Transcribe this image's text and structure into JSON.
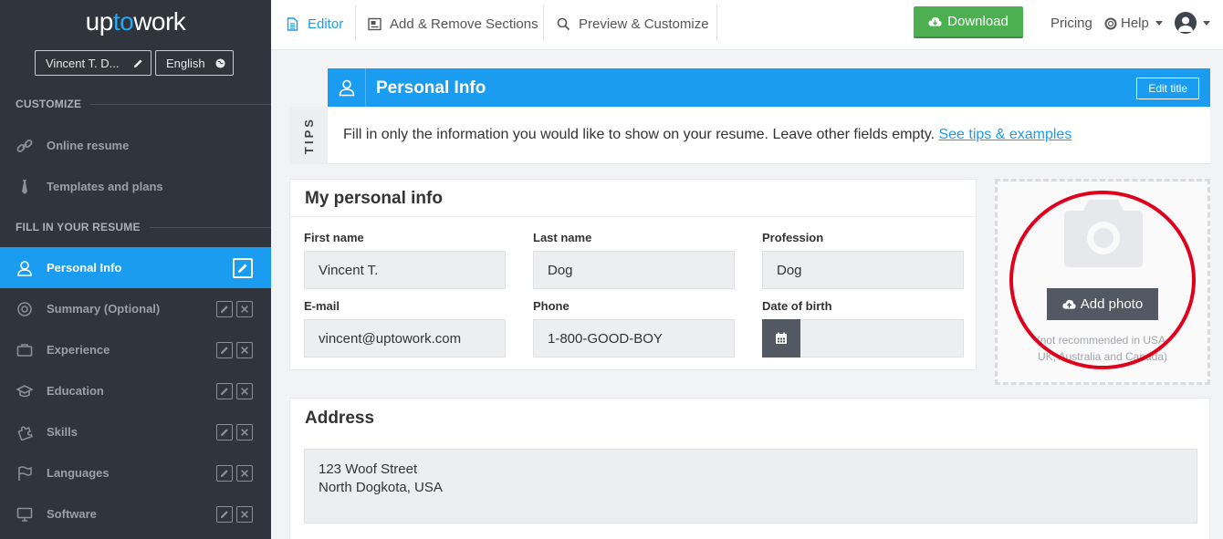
{
  "brand": {
    "prefix": "up",
    "mid": "to",
    "suffix": "work"
  },
  "sidebar": {
    "resume_name": "Vincent T. D...",
    "language": "English",
    "customize_header": "CUSTOMIZE",
    "customize_items": [
      {
        "label": "Online resume",
        "icon": "link-icon"
      },
      {
        "label": "Templates and plans",
        "icon": "tie-icon"
      }
    ],
    "fill_header": "FILL IN YOUR RESUME",
    "items": [
      {
        "label": "Personal Info",
        "icon": "user-icon",
        "active": true
      },
      {
        "label": "Summary (Optional)",
        "icon": "target-icon"
      },
      {
        "label": "Experience",
        "icon": "briefcase-icon"
      },
      {
        "label": "Education",
        "icon": "graduation-cap-icon"
      },
      {
        "label": "Skills",
        "icon": "puzzle-icon"
      },
      {
        "label": "Languages",
        "icon": "flag-icon"
      },
      {
        "label": "Software",
        "icon": "monitor-icon"
      }
    ]
  },
  "topbar": {
    "tabs": [
      {
        "label": "Editor",
        "icon": "document-icon",
        "active": true
      },
      {
        "label": "Add & Remove Sections",
        "icon": "layout-icon"
      },
      {
        "label": "Preview & Customize",
        "icon": "search-icon"
      }
    ],
    "download": "Download",
    "pricing": "Pricing",
    "help": "Help"
  },
  "section": {
    "title": "Personal Info",
    "edit_title": "Edit title",
    "tips_label": "TIPS",
    "tips_text": "Fill in only the information you would like to show on your resume. Leave other fields empty. ",
    "tips_link": "See tips & examples"
  },
  "personal": {
    "card_title": "My personal info",
    "first_name_label": "First name",
    "first_name": "Vincent T.",
    "last_name_label": "Last name",
    "last_name": "Dog",
    "profession_label": "Profession",
    "profession": "Dog",
    "email_label": "E-mail",
    "email": "vincent@uptowork.com",
    "phone_label": "Phone",
    "phone": "1-800-GOOD-BOY",
    "dob_label": "Date of birth",
    "dob": ""
  },
  "photo": {
    "button": "Add photo",
    "note": "(not recommended in USA, UK, Australia and Canada)"
  },
  "address": {
    "title": "Address",
    "line1": "123 Woof Street",
    "line2": "North Dogkota, USA"
  },
  "colors": {
    "accent": "#1a9cf0",
    "sidebar_bg": "#2f343d",
    "download_green": "#4caf50",
    "highlight_red": "#e1001b"
  }
}
